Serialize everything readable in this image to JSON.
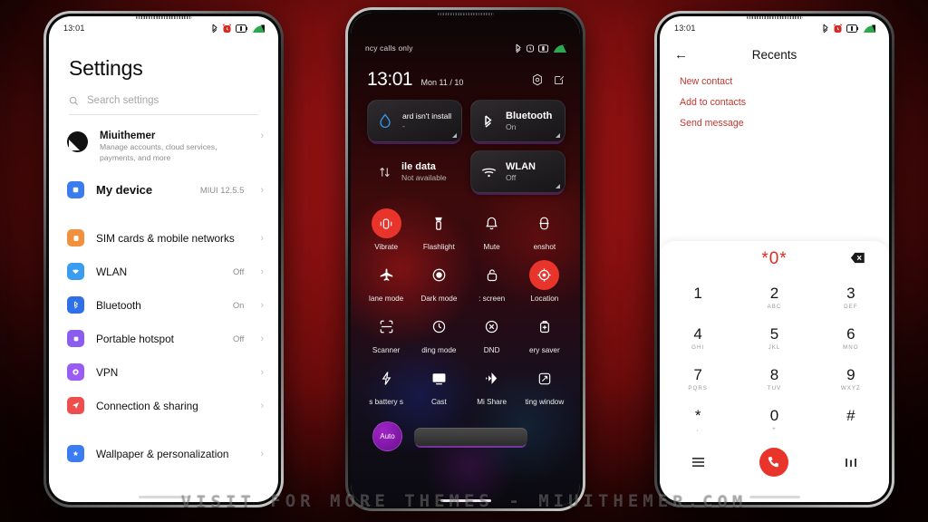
{
  "background": {
    "color": "#8c1111"
  },
  "watermark": {
    "text": "VISIT FOR MORE THEMES - MIUITHEMER.COM"
  },
  "status_bar": {
    "time": "13:01"
  },
  "settings_phone": {
    "title": "Settings",
    "search": {
      "placeholder": "Search settings"
    },
    "account": {
      "name": "Miuithemer",
      "subtitle": "Manage accounts, cloud services, payments, and more"
    },
    "items": [
      {
        "label": "My device",
        "value": "MIUI 12.5.5",
        "color": "#3b7df0",
        "icon": "device-icon",
        "bold": true
      },
      {
        "label": "SIM cards & mobile networks",
        "value": "",
        "color": "#f2913d",
        "icon": "sim-icon"
      },
      {
        "label": "WLAN",
        "value": "Off",
        "color": "#3b9df0",
        "icon": "wifi-icon"
      },
      {
        "label": "Bluetooth",
        "value": "On",
        "color": "#2f6fe8",
        "icon": "bluetooth-icon"
      },
      {
        "label": "Portable hotspot",
        "value": "Off",
        "color": "#8a5cf0",
        "icon": "hotspot-icon"
      },
      {
        "label": "VPN",
        "value": "",
        "color": "#9a5cf5",
        "icon": "vpn-icon"
      },
      {
        "label": "Connection & sharing",
        "value": "",
        "color": "#ef4e4e",
        "icon": "share-icon"
      },
      {
        "label": "Wallpaper & personalization",
        "value": "",
        "color": "#3b7df0",
        "icon": "wallpaper-icon"
      }
    ]
  },
  "control_center": {
    "carrier": "ncy calls only",
    "time": "13:01",
    "date": "Mon 11 / 10",
    "cards": [
      {
        "title": "ard isn't install",
        "subtitle": "-",
        "icon": "water-drop-icon",
        "small_title": true
      },
      {
        "title": "Bluetooth",
        "subtitle": "On",
        "icon": "bluetooth-icon",
        "small_title": false
      },
      {
        "title": "ile data",
        "subtitle": "Not available",
        "icon": "mobile-data-icon",
        "borderless": true
      },
      {
        "title": "WLAN",
        "subtitle": "Off",
        "icon": "wifi-icon",
        "small_title": false
      }
    ],
    "toggles": [
      {
        "label": "Vibrate",
        "icon": "vibrate-icon",
        "on": true
      },
      {
        "label": "Flashlight",
        "icon": "flashlight-icon",
        "on": false
      },
      {
        "label": "Mute",
        "icon": "bell-icon",
        "on": false
      },
      {
        "label": "enshot",
        "icon": "screenshot-icon",
        "on": false
      },
      {
        "label": "lane mode",
        "icon": "airplane-icon",
        "on": false
      },
      {
        "label": "Dark mode",
        "icon": "dark-mode-icon",
        "on": false
      },
      {
        "label": ": screen",
        "icon": "lock-icon",
        "on": false
      },
      {
        "label": "Location",
        "icon": "location-icon",
        "on": true
      },
      {
        "label": "Scanner",
        "icon": "scanner-icon",
        "on": false
      },
      {
        "label": "ding mode",
        "icon": "reading-mode-icon",
        "on": false
      },
      {
        "label": "DND",
        "icon": "dnd-icon",
        "on": false
      },
      {
        "label": "ery saver",
        "icon": "battery-saver-icon",
        "on": false
      },
      {
        "label": "s battery s",
        "icon": "ultra-battery-icon",
        "on": false
      },
      {
        "label": "Cast",
        "icon": "cast-icon",
        "on": false
      },
      {
        "label": "Mi Share",
        "icon": "mi-share-icon",
        "on": false
      },
      {
        "label": "ting window",
        "icon": "floating-window-icon",
        "on": false
      }
    ],
    "brightness": {
      "auto_label": "Auto"
    },
    "accent_color": "#e8342b"
  },
  "dialer_phone": {
    "header": {
      "title": "Recents",
      "back_icon": "arrow-left-icon"
    },
    "options": [
      {
        "label": "New contact"
      },
      {
        "label": "Add to contacts"
      },
      {
        "label": "Send message"
      }
    ],
    "number": "*0*",
    "delete_icon": "backspace-icon",
    "keys": [
      {
        "n": "1",
        "l": ""
      },
      {
        "n": "2",
        "l": "ABC"
      },
      {
        "n": "3",
        "l": "DEF"
      },
      {
        "n": "4",
        "l": "GHI"
      },
      {
        "n": "5",
        "l": "JKL"
      },
      {
        "n": "6",
        "l": "MNO"
      },
      {
        "n": "7",
        "l": "PQRS"
      },
      {
        "n": "8",
        "l": "TUV"
      },
      {
        "n": "9",
        "l": "WXYZ"
      },
      {
        "n": "*",
        "l": ","
      },
      {
        "n": "0",
        "l": "+"
      },
      {
        "n": "#",
        "l": ""
      }
    ],
    "bottom": {
      "menu_icon": "menu-icon",
      "call_icon": "call-icon",
      "keypad_icon": "dialpad-icon"
    },
    "text_color": "#c1362f",
    "call_color": "#e8342b"
  }
}
